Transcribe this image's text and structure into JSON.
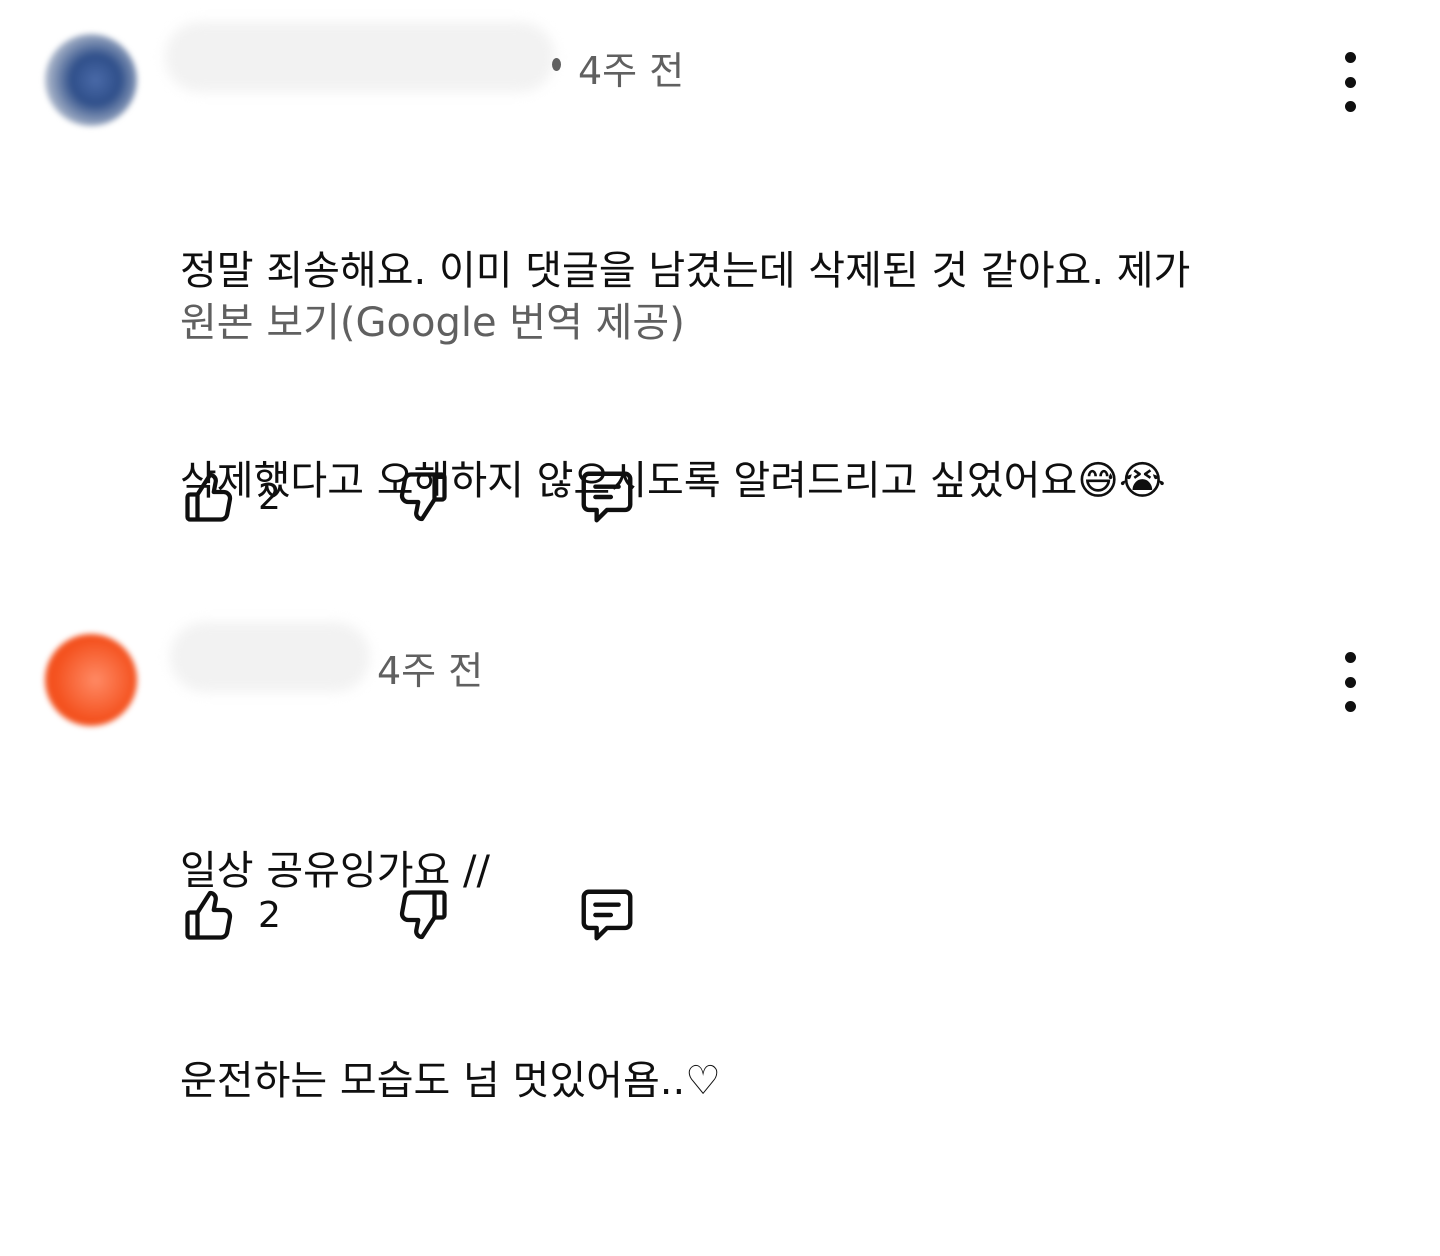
{
  "comments": [
    {
      "avatar_color": "#2f4f8a",
      "time": "4주 전",
      "text_lines": [
        "정말 죄송해요. 이미 댓글을 남겼는데 삭제된 것 같아요. 제가",
        "삭제했다고 오해하지 않으시도록 알려드리고 싶었어요😅😭"
      ],
      "translate_link": "원본 보기(Google 번역 제공)",
      "like_count": "2",
      "icons": {
        "like": "thumbs-up-icon",
        "dislike": "thumbs-down-icon",
        "reply": "reply-icon",
        "more": "more-vert-icon"
      }
    },
    {
      "avatar_color": "#f4511e",
      "time": "4주 전",
      "text_lines": [
        "일상 공유잉가요 //",
        "운전하는 모습도 넘 멋있어욤..♡"
      ],
      "like_count": "2",
      "icons": {
        "like": "thumbs-up-icon",
        "dislike": "thumbs-down-icon",
        "reply": "reply-icon",
        "more": "more-vert-icon"
      }
    }
  ]
}
